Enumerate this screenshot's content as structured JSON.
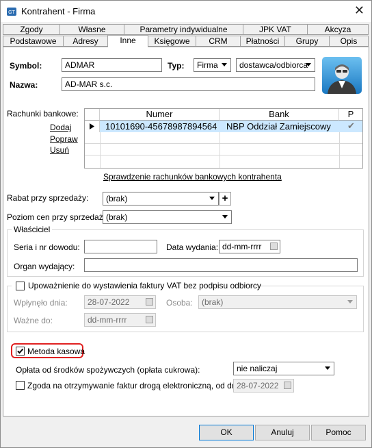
{
  "window": {
    "title": "Kontrahent - Firma",
    "close": "✕"
  },
  "tabs_row1": [
    {
      "label": "Zgody"
    },
    {
      "label": "Własne"
    },
    {
      "label": "Parametry indywidualne"
    },
    {
      "label": "JPK VAT"
    },
    {
      "label": "Akcyza"
    }
  ],
  "tabs_row2": [
    {
      "label": "Podstawowe"
    },
    {
      "label": "Adresy"
    },
    {
      "label": "Inne"
    },
    {
      "label": "Księgowe"
    },
    {
      "label": "CRM"
    },
    {
      "label": "Płatności"
    },
    {
      "label": "Grupy"
    },
    {
      "label": "Opis"
    }
  ],
  "active_tab": "Inne",
  "header": {
    "symbol_label": "Symbol:",
    "symbol_value": "ADMAR",
    "typ_label": "Typ:",
    "typ_value": "Firma",
    "typ2_value": "dostawca/odbiorca",
    "nazwa_label": "Nazwa:",
    "nazwa_value": "AD-MAR s.c."
  },
  "accounts": {
    "label": "Rachunki bankowe:",
    "actions": [
      "Dodaj",
      "Popraw",
      "Usuń"
    ],
    "columns": [
      "Numer",
      "Bank",
      "P"
    ],
    "rows": [
      {
        "numer": "10101690-45678987894564",
        "bank": "NBP Oddział Zamiejscowy",
        "p": "✔"
      }
    ],
    "check_link": "Sprawdzenie rachunków bankowych kontrahenta"
  },
  "rabat": {
    "label": "Rabat przy sprzedaży:",
    "value": "(brak)",
    "plus": "+"
  },
  "poziom": {
    "label": "Poziom cen przy sprzedaży:",
    "value": "(brak)"
  },
  "wlasciciel": {
    "title": "Właściciel",
    "seria_label": "Seria i nr dowodu:",
    "seria_value": "",
    "data_label": "Data wydania:",
    "data_value": "dd-mm-rrrr",
    "organ_label": "Organ wydający:",
    "organ_value": ""
  },
  "upowaznienie": {
    "title": "Upoważnienie do wystawienia faktury VAT bez podpisu odbiorcy",
    "wplynelo_label": "Wpłynęło dnia:",
    "wplynelo_value": "28-07-2022",
    "osoba_label": "Osoba:",
    "osoba_value": "(brak)",
    "wazne_label": "Ważne do:",
    "wazne_value": "dd-mm-rrrr"
  },
  "metoda": {
    "label": "Metoda kasowa",
    "checked": true
  },
  "oplata": {
    "label": "Opłata od środków spożywczych (opłata cukrowa):",
    "value": "nie naliczaj"
  },
  "zgoda": {
    "label": "Zgoda na otrzymywanie faktur drogą elektroniczną, od dnia:",
    "value": "28-07-2022"
  },
  "buttons": {
    "ok": "OK",
    "cancel": "Anuluj",
    "help": "Pomoc"
  },
  "colors": {
    "highlight_border": "#e02020",
    "default_button_border": "#0078d7"
  }
}
